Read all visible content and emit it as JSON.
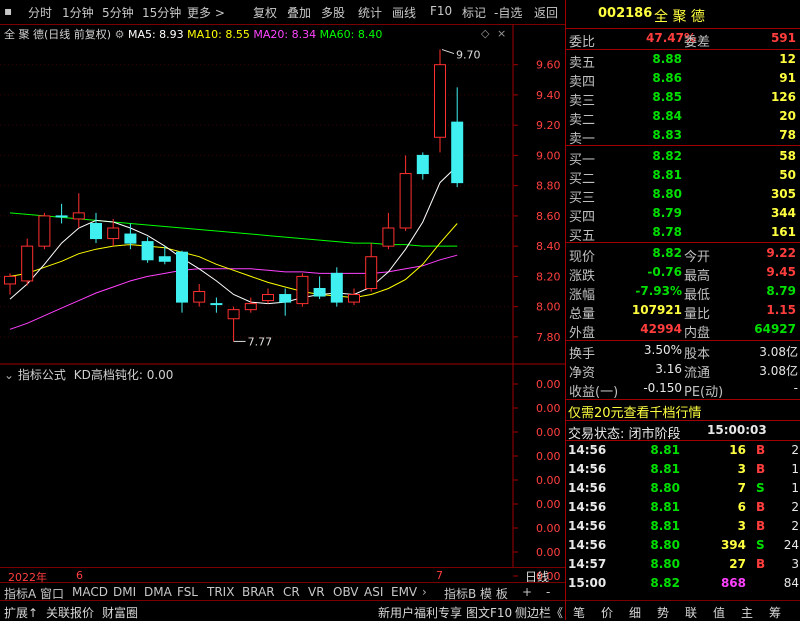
{
  "toolbar": {
    "items": [
      "分时",
      "1分钟",
      "5分钟",
      "15分钟",
      "更多 >",
      "复权",
      "叠加",
      "多股",
      "统计",
      "画线",
      "F10",
      "标记",
      "-自选",
      "返回"
    ]
  },
  "chart": {
    "stock_label": "全 聚 德(日线 前复权)",
    "ma5": "MA5: 8.93",
    "ma10": "MA10: 8.55",
    "ma20": "MA20: 8.34",
    "ma60": "MA60: 8.40",
    "high_marker": "9.70",
    "low_marker": "7.77",
    "price_axis": [
      "9.60",
      "9.40",
      "9.20",
      "9.00",
      "8.80",
      "8.60",
      "8.40",
      "8.20",
      "8.00",
      "7.80"
    ],
    "indicator_title": "指标公式",
    "indicator_name": "KD高档钝化: 0.00",
    "indicator_axis": [
      "0.00",
      "0.00",
      "0.00",
      "0.00",
      "0.00",
      "0.00",
      "0.00",
      "0.00",
      "0.00"
    ],
    "date_year": "2022年",
    "date_month1": "6",
    "date_month2": "7",
    "period": "日线",
    "colors": {
      "up": "#ff3030",
      "down": "#40f0f0",
      "ma5": "#ffffff",
      "ma10": "#ffff00",
      "ma20": "#ff40ff",
      "ma60": "#00ff00"
    }
  },
  "chart_data": {
    "type": "candlestick",
    "title": "全 聚 德(日线 前复权)",
    "ylim": [
      7.7,
      9.75
    ],
    "candles": [
      {
        "o": 8.15,
        "c": 8.2,
        "h": 8.22,
        "l": 8.08,
        "up": true
      },
      {
        "o": 8.17,
        "c": 8.4,
        "h": 8.45,
        "l": 8.14,
        "up": true
      },
      {
        "o": 8.4,
        "c": 8.6,
        "h": 8.62,
        "l": 8.38,
        "up": true
      },
      {
        "o": 8.6,
        "c": 8.6,
        "h": 8.68,
        "l": 8.55,
        "up": false
      },
      {
        "o": 8.58,
        "c": 8.62,
        "h": 8.75,
        "l": 8.52,
        "up": true
      },
      {
        "o": 8.55,
        "c": 8.45,
        "h": 8.62,
        "l": 8.42,
        "up": false
      },
      {
        "o": 8.45,
        "c": 8.52,
        "h": 8.58,
        "l": 8.4,
        "up": true
      },
      {
        "o": 8.48,
        "c": 8.42,
        "h": 8.55,
        "l": 8.38,
        "up": false
      },
      {
        "o": 8.43,
        "c": 8.31,
        "h": 8.46,
        "l": 8.29,
        "up": false
      },
      {
        "o": 8.33,
        "c": 8.3,
        "h": 8.4,
        "l": 8.28,
        "up": false
      },
      {
        "o": 8.36,
        "c": 8.03,
        "h": 8.37,
        "l": 7.96,
        "up": false
      },
      {
        "o": 8.03,
        "c": 8.1,
        "h": 8.15,
        "l": 8.0,
        "up": true
      },
      {
        "o": 8.02,
        "c": 8.02,
        "h": 8.06,
        "l": 7.96,
        "up": false
      },
      {
        "o": 7.92,
        "c": 7.98,
        "h": 8.0,
        "l": 7.77,
        "up": true
      },
      {
        "o": 7.98,
        "c": 8.02,
        "h": 8.06,
        "l": 7.96,
        "up": true
      },
      {
        "o": 8.04,
        "c": 8.08,
        "h": 8.12,
        "l": 8.02,
        "up": true
      },
      {
        "o": 8.08,
        "c": 8.03,
        "h": 8.12,
        "l": 7.94,
        "up": false
      },
      {
        "o": 8.02,
        "c": 8.2,
        "h": 8.22,
        "l": 8.0,
        "up": true
      },
      {
        "o": 8.12,
        "c": 8.07,
        "h": 8.2,
        "l": 8.05,
        "up": false
      },
      {
        "o": 8.22,
        "c": 8.03,
        "h": 8.26,
        "l": 8.0,
        "up": false
      },
      {
        "o": 8.03,
        "c": 8.08,
        "h": 8.12,
        "l": 8.01,
        "up": true
      },
      {
        "o": 8.12,
        "c": 8.33,
        "h": 8.42,
        "l": 8.1,
        "up": true
      },
      {
        "o": 8.4,
        "c": 8.52,
        "h": 8.62,
        "l": 8.38,
        "up": true
      },
      {
        "o": 8.52,
        "c": 8.88,
        "h": 9.0,
        "l": 8.5,
        "up": true
      },
      {
        "o": 8.88,
        "c": 9.0,
        "h": 9.02,
        "l": 8.84,
        "up": false
      },
      {
        "o": 9.12,
        "c": 9.6,
        "h": 9.7,
        "l": 9.02,
        "up": true
      },
      {
        "o": 9.22,
        "c": 8.82,
        "h": 9.45,
        "l": 8.79,
        "up": false
      }
    ],
    "ma5": [
      8.05,
      8.15,
      8.28,
      8.42,
      8.52,
      8.57,
      8.56,
      8.52,
      8.47,
      8.4,
      8.32,
      8.25,
      8.17,
      8.08,
      8.03,
      8.02,
      8.03,
      8.06,
      8.08,
      8.09,
      8.08,
      8.13,
      8.23,
      8.38,
      8.56,
      8.82,
      8.93
    ],
    "ma10": [
      8.2,
      8.22,
      8.26,
      8.3,
      8.35,
      8.38,
      8.4,
      8.41,
      8.4,
      8.39,
      8.36,
      8.33,
      8.28,
      8.24,
      8.2,
      8.16,
      8.13,
      8.1,
      8.08,
      8.07,
      8.06,
      8.08,
      8.12,
      8.18,
      8.28,
      8.42,
      8.55
    ],
    "ma20": [
      7.85,
      7.89,
      7.94,
      7.99,
      8.04,
      8.09,
      8.13,
      8.17,
      8.2,
      8.22,
      8.24,
      8.25,
      8.25,
      8.25,
      8.25,
      8.24,
      8.23,
      8.23,
      8.22,
      8.22,
      8.22,
      8.22,
      8.23,
      8.25,
      8.27,
      8.31,
      8.34
    ],
    "ma60": [
      8.62,
      8.61,
      8.6,
      8.59,
      8.58,
      8.57,
      8.56,
      8.55,
      8.54,
      8.53,
      8.52,
      8.51,
      8.5,
      8.49,
      8.48,
      8.47,
      8.46,
      8.45,
      8.44,
      8.43,
      8.42,
      8.42,
      8.41,
      8.41,
      8.4,
      8.4,
      8.4
    ]
  },
  "quote": {
    "code": "002186",
    "name": "全 聚 德",
    "weibi_label": "委比",
    "weibi": "47.47%",
    "weicha_label": "委差",
    "weicha": "591",
    "sells": [
      {
        "label": "卖五",
        "price": "8.88",
        "vol": "12"
      },
      {
        "label": "卖四",
        "price": "8.86",
        "vol": "91"
      },
      {
        "label": "卖三",
        "price": "8.85",
        "vol": "126"
      },
      {
        "label": "卖二",
        "price": "8.84",
        "vol": "20"
      },
      {
        "label": "卖一",
        "price": "8.83",
        "vol": "78"
      }
    ],
    "buys": [
      {
        "label": "买一",
        "price": "8.82",
        "vol": "58"
      },
      {
        "label": "买二",
        "price": "8.81",
        "vol": "50"
      },
      {
        "label": "买三",
        "price": "8.80",
        "vol": "305"
      },
      {
        "label": "买四",
        "price": "8.79",
        "vol": "344"
      },
      {
        "label": "买五",
        "price": "8.78",
        "vol": "161"
      }
    ],
    "stats": [
      {
        "l1": "现价",
        "v1": "8.82",
        "c1": "green",
        "l2": "今开",
        "v2": "9.22",
        "c2": "red"
      },
      {
        "l1": "涨跌",
        "v1": "-0.76",
        "c1": "green",
        "l2": "最高",
        "v2": "9.45",
        "c2": "red"
      },
      {
        "l1": "涨幅",
        "v1": "-7.93%",
        "c1": "green",
        "l2": "最低",
        "v2": "8.79",
        "c2": "green"
      },
      {
        "l1": "总量",
        "v1": "107921",
        "c1": "yellow",
        "l2": "量比",
        "v2": "1.15",
        "c2": "red"
      },
      {
        "l1": "外盘",
        "v1": "42994",
        "c1": "red",
        "l2": "内盘",
        "v2": "64927",
        "c2": "green"
      }
    ],
    "fin": [
      {
        "l1": "换手",
        "v1": "3.50%",
        "l2": "股本",
        "v2": "3.08亿"
      },
      {
        "l1": "净资",
        "v1": "3.16",
        "l2": "流通",
        "v2": "3.08亿"
      },
      {
        "l1": "收益(一)",
        "v1": "-0.150",
        "l2": "PE(动)",
        "v2": "-"
      }
    ],
    "promo": "仅需20元查看千档行情",
    "status_label": "交易状态: 闭市阶段",
    "status_time": "15:00:03",
    "ticks": [
      {
        "t": "14:56",
        "p": "8.81",
        "v": "16",
        "bs": "B",
        "n": "2"
      },
      {
        "t": "14:56",
        "p": "8.81",
        "v": "3",
        "bs": "B",
        "n": "1"
      },
      {
        "t": "14:56",
        "p": "8.80",
        "v": "7",
        "bs": "S",
        "n": "1"
      },
      {
        "t": "14:56",
        "p": "8.81",
        "v": "6",
        "bs": "B",
        "n": "2"
      },
      {
        "t": "14:56",
        "p": "8.81",
        "v": "3",
        "bs": "B",
        "n": "2"
      },
      {
        "t": "14:56",
        "p": "8.80",
        "v": "394",
        "bs": "S",
        "n": "24"
      },
      {
        "t": "14:57",
        "p": "8.80",
        "v": "27",
        "bs": "B",
        "n": "3"
      },
      {
        "t": "15:00",
        "p": "8.82",
        "v": "868",
        "bs": "",
        "n": "84"
      }
    ]
  },
  "bottom": {
    "tabs": [
      "指标A",
      "窗口",
      "MACD",
      "DMI",
      "DMA",
      "FSL",
      "TRIX",
      "BRAR",
      "CR",
      "VR",
      "OBV",
      "ASI",
      "EMV"
    ],
    "right_tabs": [
      "指标B",
      "模 板",
      "+",
      "-"
    ],
    "bar2_left": [
      "扩展↑",
      "关联报价",
      "财富圈"
    ],
    "bar2_mid": [
      "新用户福利专享",
      "图文F10",
      "侧边栏《"
    ],
    "bar2_right": [
      "笔",
      "价",
      "细",
      "势",
      "联",
      "值",
      "主",
      "筹"
    ]
  }
}
